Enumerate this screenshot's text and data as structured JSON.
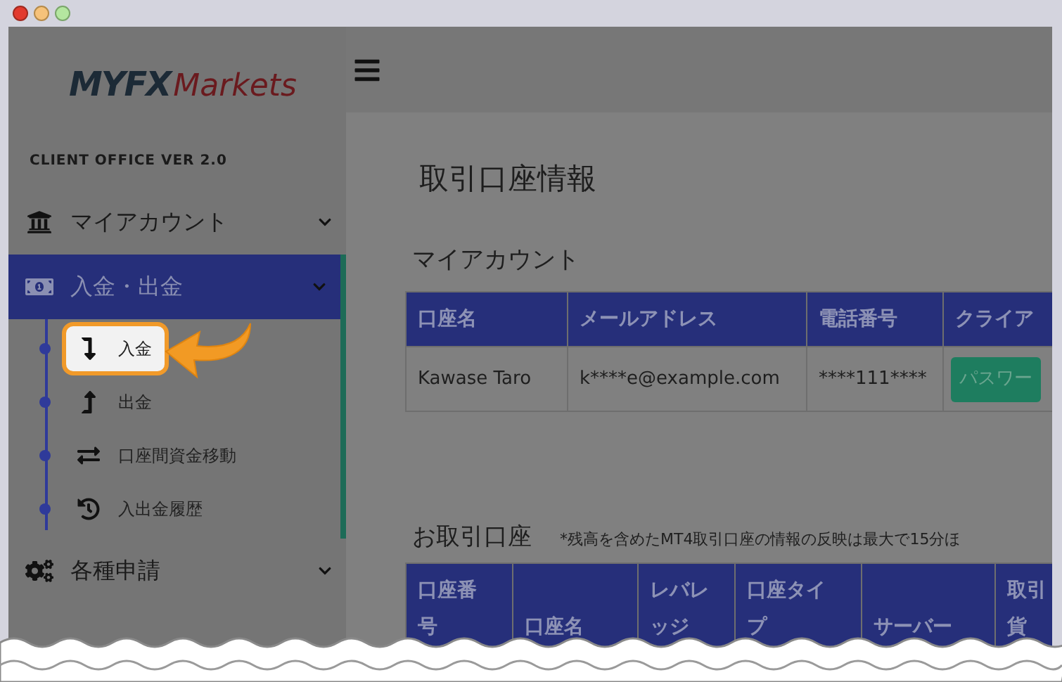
{
  "logo": {
    "brand": "MYFX",
    "suffix": "Markets"
  },
  "version_label": "CLIENT OFFICE VER 2.0",
  "nav": [
    {
      "label": "マイアカウント",
      "expanded": false,
      "selected": false
    },
    {
      "label": "入金・出金",
      "expanded": true,
      "selected": true,
      "children": [
        {
          "label": "入金",
          "selected": true
        },
        {
          "label": "出金",
          "selected": false
        },
        {
          "label": "口座間資金移動",
          "selected": false
        },
        {
          "label": "入出金履歴",
          "selected": false
        }
      ]
    },
    {
      "label": "各種申請",
      "expanded": false,
      "selected": false
    }
  ],
  "page_title": "取引口座情報",
  "my_account": {
    "heading": "マイアカウント",
    "columns": [
      [
        "口座名"
      ],
      [
        "メールアドレス"
      ],
      [
        "電話番号"
      ],
      [
        "クライア"
      ]
    ],
    "rows": [
      {
        "name": "Kawase Taro",
        "email": "k****e@example.com",
        "phone": "****111****",
        "button": "パスワー"
      }
    ]
  },
  "trading_accounts": {
    "heading": "お取引口座",
    "note": "*残高を含めたMT4取引口座の情報の反映は最大で15分ほ",
    "columns": [
      [
        "口座番",
        "号"
      ],
      [
        "口座名"
      ],
      [
        "レバレ",
        "ッジ"
      ],
      [
        "口座タイ",
        "プ"
      ],
      [
        "サーバー"
      ],
      [
        "取引",
        "貨"
      ]
    ]
  }
}
